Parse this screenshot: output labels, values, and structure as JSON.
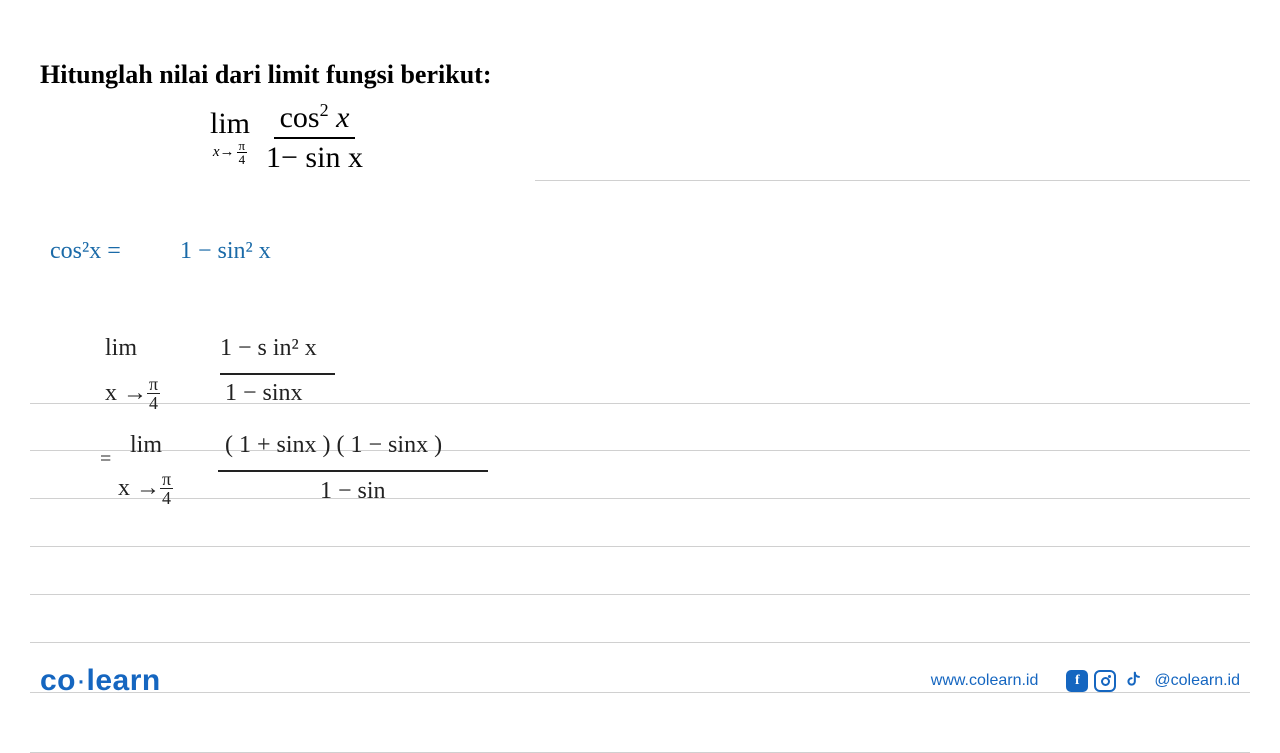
{
  "title": "Hitunglah nilai dari limit fungsi berikut:",
  "formula": {
    "lim": "lim",
    "approach_var": "x→",
    "approach_frac_num": "π",
    "approach_frac_den": "4",
    "numerator_left": "cos",
    "numerator_sup": "2",
    "numerator_var": " x",
    "denominator": "1− sin x"
  },
  "handwriting": {
    "identity_left": "cos²x =",
    "identity_right": "1 − sin² x",
    "step1_lim": "lim",
    "step1_approach": "x → ",
    "step1_frac_n": "π",
    "step1_frac_d": "4",
    "step1_num": "1 − s in² x",
    "step1_den": "1 − sinx",
    "step2_eq": "=",
    "step2_lim": "lim",
    "step2_approach": "x → ",
    "step2_frac_n": "π",
    "step2_frac_d": "4",
    "step2_num": "( 1 + sinx )  ( 1 − sinx )",
    "step2_den": "1 − sin"
  },
  "footer": {
    "logo_co": "co",
    "logo_dot": "·",
    "logo_learn": "learn",
    "website": "www.colearn.id",
    "handle": "@colearn.id"
  }
}
